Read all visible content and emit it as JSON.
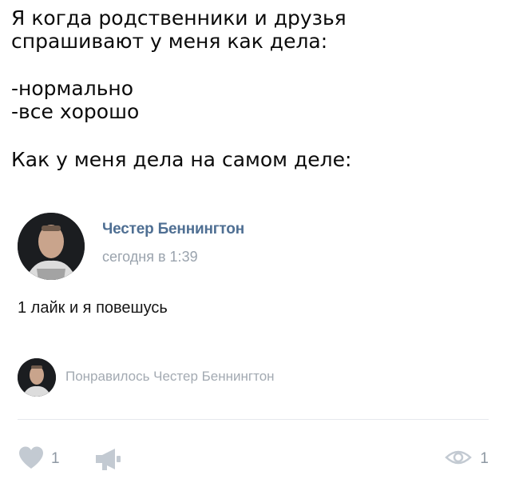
{
  "caption": {
    "line1": "Я когда родственники и друзья",
    "line2": "спрашивают у меня как дела:",
    "line3": "-нормально",
    "line4": "-все хорошо",
    "line5": "Как у меня дела на самом деле:"
  },
  "post": {
    "author": "Честер Беннингтон",
    "time": "сегодня в 1:39",
    "text": "1 лайк и я повешусь",
    "liked_by": "Понравилось Честер Беннингтон",
    "likes": "1",
    "views": "1"
  },
  "icons": {
    "like": "heart-icon",
    "share": "megaphone-icon",
    "views": "eye-icon"
  },
  "colors": {
    "author_link": "#4f6f93",
    "muted": "#9aa3ad",
    "icon_gray": "#c3cad2"
  }
}
